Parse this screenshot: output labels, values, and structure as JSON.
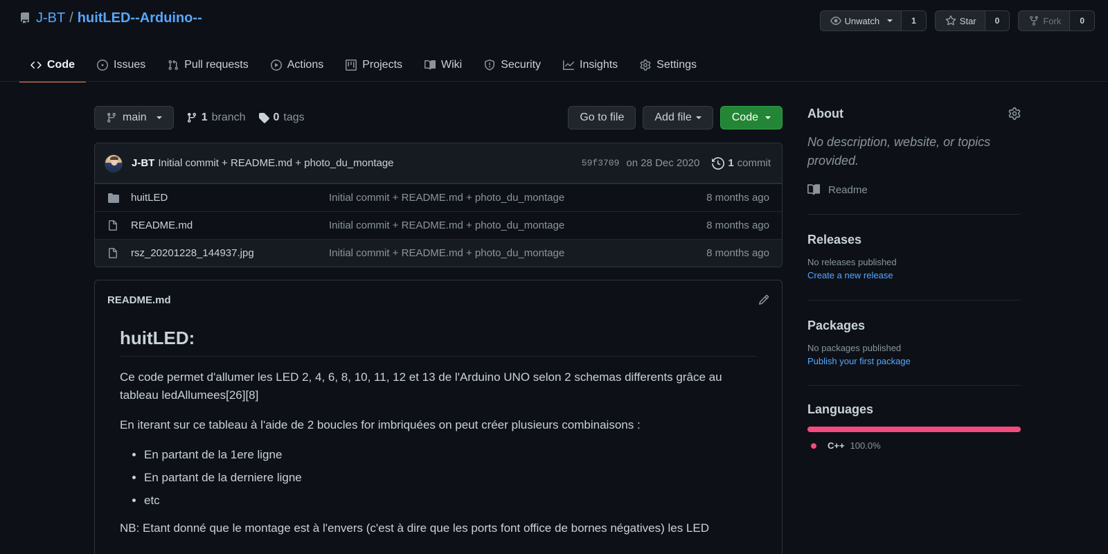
{
  "repo": {
    "owner": "J-BT",
    "separator": "/",
    "name": "huitLED--Arduino--"
  },
  "header_actions": {
    "watch": {
      "label": "Unwatch",
      "count": "1"
    },
    "star": {
      "label": "Star",
      "count": "0"
    },
    "fork": {
      "label": "Fork",
      "count": "0"
    }
  },
  "nav": {
    "code": "Code",
    "issues": "Issues",
    "pulls": "Pull requests",
    "actions": "Actions",
    "projects": "Projects",
    "wiki": "Wiki",
    "security": "Security",
    "insights": "Insights",
    "settings": "Settings"
  },
  "toolbar": {
    "branch": "main",
    "branch_count": "1",
    "branch_word": "branch",
    "tag_count": "0",
    "tag_word": "tags",
    "go_to_file": "Go to file",
    "add_file": "Add file",
    "code": "Code"
  },
  "commit": {
    "author": "J-BT",
    "message": "Initial commit + README.md + photo_du_montage",
    "sha": "59f3709",
    "date": "on 28 Dec 2020",
    "count": "1",
    "count_word": "commit"
  },
  "files": [
    {
      "name": "huitLED",
      "type": "folder",
      "message": "Initial commit + README.md + photo_du_montage",
      "age": "8 months ago"
    },
    {
      "name": "README.md",
      "type": "file",
      "message": "Initial commit + README.md + photo_du_montage",
      "age": "8 months ago"
    },
    {
      "name": "rsz_20201228_144937.jpg",
      "type": "file",
      "message": "Initial commit + README.md + photo_du_montage",
      "age": "8 months ago"
    }
  ],
  "readme": {
    "filename": "README.md",
    "heading": "huitLED:",
    "p1": "Ce code permet d'allumer les LED 2, 4, 6, 8, 10, 11, 12 et 13 de l'Arduino UNO selon 2 schemas differents grâce au tableau ledAllumees[26][8]",
    "p2": "En iterant sur ce tableau à l'aide de 2 boucles for imbriquées on peut créer plusieurs combinaisons :",
    "list": [
      "En partant de la 1ere ligne",
      "En partant de la derniere ligne",
      "etc"
    ],
    "p3": "NB: Etant donné que le montage est à l'envers (c'est à dire que les ports font office de bornes négatives) les LED"
  },
  "sidebar": {
    "about_title": "About",
    "about_desc": "No description, website, or topics provided.",
    "readme_link": "Readme",
    "releases_title": "Releases",
    "releases_none": "No releases published",
    "releases_link": "Create a new release",
    "packages_title": "Packages",
    "packages_none": "No packages published",
    "packages_link": "Publish your first package",
    "languages_title": "Languages",
    "language": {
      "name": "C++",
      "percent": "100.0%",
      "share": 100,
      "color": "#f34b7d"
    }
  },
  "colors": {
    "accent_link": "#58a6ff",
    "green_button": "#238636",
    "active_tab": "#f78166",
    "background": "#0d1117"
  }
}
